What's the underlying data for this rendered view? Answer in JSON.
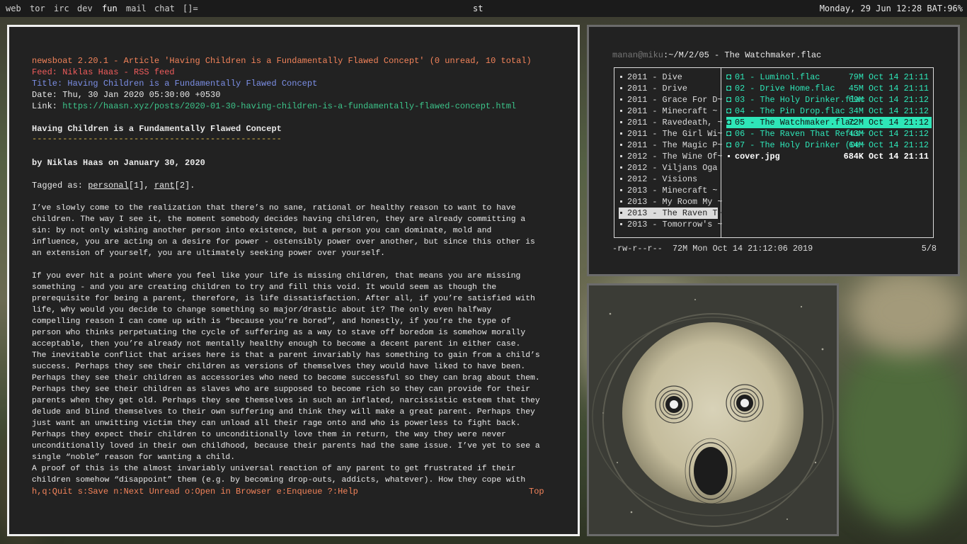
{
  "topbar": {
    "workspaces": [
      {
        "label": "web",
        "active": false
      },
      {
        "label": "tor",
        "active": false
      },
      {
        "label": "irc",
        "active": false
      },
      {
        "label": "dev",
        "active": false
      },
      {
        "label": "fun",
        "active": true
      },
      {
        "label": "mail",
        "active": false
      },
      {
        "label": "chat",
        "active": false
      },
      {
        "label": "[]=",
        "active": false
      }
    ],
    "window_title": "st",
    "status": "Monday, 29 Jun 12:28  BAT:96%"
  },
  "newsboat": {
    "header": "newsboat 2.20.1 - Article 'Having Children is a Fundamentally Flawed Concept' (0 unread, 10 total)",
    "feed": "Feed: Niklas Haas - RSS feed",
    "title": "Title: Having Children is a Fundamentally Flawed Concept",
    "date": "Date: Thu, 30 Jan 2020 05:30:00 +0530",
    "link_label": "Link: ",
    "link_url": "https://haasn.xyz/posts/2020-01-30-having-children-is-a-fundamentally-flawed-concept.html",
    "article_title": "Having Children is a Fundamentally Flawed Concept",
    "underline": "-------------------------------------------------",
    "byline": "by Niklas Haas on January 30, 2020",
    "tagged_prefix": "Tagged as: ",
    "tag1": "personal",
    "tag1_ref": "[1], ",
    "tag2": "rant",
    "tag2_ref": "[2].",
    "paragraphs": [
      "I’ve slowly come to the realization that there’s no sane, rational or healthy reason to want to have children. The way I see it, the moment somebody decides having children, they are already committing a sin: by not only wishing another person into existence, but a person you can dominate, mold and influence, you are acting on a desire for power - ostensibly power over another, but since this other is an extension of yourself, you are ultimately seeking power over yourself.",
      "If you ever hit a point where you feel like your life is missing children, that means you are missing something - and you are creating children to try and fill this void. It would seem as though the prerequisite for being a parent, therefore, is life dissatisfaction. After all, if you’re satisfied with life, why would you decide to change something so major/drastic about it? The only even halfway compelling reason I can come up with is “because you’re bored”, and honestly, if you’re the type of person who thinks perpetuating the cycle of suffering as a way to stave off boredom is somehow morally acceptable, then you’re already not mentally healthy enough to become a decent parent in either case.",
      "The inevitable conflict that arises here is that a parent invariably has something to gain from a child’s success. Perhaps they see their children as versions of themselves they would have liked to have been. Perhaps they see their children as accessories who need to become successful so they can brag about them. Perhaps they see their children as slaves who are supposed to become rich so they can provide for their parents when they get old. Perhaps they see themselves in such an inflated, narcissistic esteem that they delude and blind themselves to their own suffering and think they will make a great parent. Perhaps they just want an unwitting victim they can unload all their rage onto and who is powerless to fight back. Perhaps they expect their children to unconditionally love them in return, the way they were never unconditionally loved in their own childhood, because their parents had the same issue. I’ve yet to see a single “noble” reason for wanting a child.",
      "A proof of this is the almost invariably universal reaction of any parent to get frustrated if their children somehow “disappoint” them (e.g. by becoming drop-outs, addicts, whatever). How they cope with that frustration is a different"
    ],
    "footer_keys": "h,q:Quit s:Save n:Next Unread o:Open in Browser e:Enqueue ?:Help",
    "footer_pos": "Top"
  },
  "ranger": {
    "user_host": "manan@miku",
    "path": ":~/M/2/05 - The Watchmaker.flac",
    "dirs": [
      {
        "label": "2011 - Dive",
        "selected": false
      },
      {
        "label": "2011 - Drive",
        "selected": false
      },
      {
        "label": "2011 - Grace For D~",
        "selected": false
      },
      {
        "label": "2011 - Minecraft ~",
        "selected": false
      },
      {
        "label": "2011 - Ravedeath, ~",
        "selected": false
      },
      {
        "label": "2011 - The Girl Wi~",
        "selected": false
      },
      {
        "label": "2011 - The Magic P~",
        "selected": false
      },
      {
        "label": "2012 - The Wine Of~",
        "selected": false
      },
      {
        "label": "2012 - Viljans Oga",
        "selected": false
      },
      {
        "label": "2012 - Visions",
        "selected": false
      },
      {
        "label": "2013 - Minecraft ~",
        "selected": false
      },
      {
        "label": "2013 - My Room My ~",
        "selected": false
      },
      {
        "label": "2013 - The Raven T~",
        "selected": true
      },
      {
        "label": "2013 - Tomorrow's ~",
        "selected": false
      }
    ],
    "files": [
      {
        "name": "01 - Luminol.flac",
        "meta": "79M Oct 14 21:11",
        "selected": false,
        "plain": false
      },
      {
        "name": "02 - Drive Home.flac",
        "meta": "45M Oct 14 21:11",
        "selected": false,
        "plain": false
      },
      {
        "name": "03 - The Holy Drinker.flac",
        "meta": "69M Oct 14 21:12",
        "selected": false,
        "plain": false
      },
      {
        "name": "04 - The Pin Drop.flac",
        "meta": "34M Oct 14 21:12",
        "selected": false,
        "plain": false
      },
      {
        "name": "05 - The Watchmaker.flac",
        "meta": "72M Oct 14 21:12",
        "selected": true,
        "plain": false
      },
      {
        "name": "06 - The Raven That Refus~",
        "meta": "43M Oct 14 21:12",
        "selected": false,
        "plain": false
      },
      {
        "name": "07 - The Holy Drinker (De~",
        "meta": "64M Oct 14 21:12",
        "selected": false,
        "plain": false
      },
      {
        "name": "cover.jpg",
        "meta": "684K Oct 14 21:11",
        "selected": false,
        "plain": true
      }
    ],
    "status": "-rw-r--r--  72M Mon Oct 14 21:12:06 2019",
    "position": "5/8"
  },
  "colors": {
    "accent_cyan": "#2ee6b8",
    "orange": "#f2835a",
    "red": "#f05c5c",
    "blue": "#7c8fe6",
    "green": "#3cc48a",
    "yellow": "#d9b64a"
  }
}
